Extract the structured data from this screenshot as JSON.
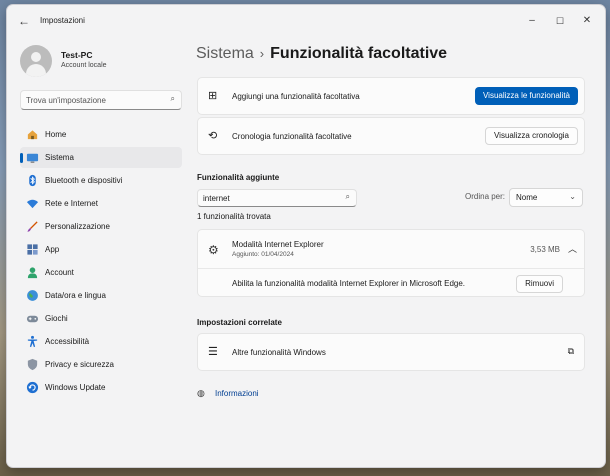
{
  "window": {
    "title": "Impostazioni",
    "back_glyph": "←",
    "min_glyph": "–",
    "max_glyph": "☐",
    "close_glyph": "✕"
  },
  "user": {
    "name": "Test-PC",
    "account_type": "Account locale"
  },
  "search": {
    "placeholder": "Trova un'impostazione",
    "icon": "search-icon"
  },
  "sidebar": {
    "selected": "Sistema",
    "items": [
      {
        "label": "Home",
        "icon": "home-icon"
      },
      {
        "label": "Sistema",
        "icon": "monitor-icon"
      },
      {
        "label": "Bluetooth e dispositivi",
        "icon": "bluetooth-icon"
      },
      {
        "label": "Rete e Internet",
        "icon": "wifi-icon"
      },
      {
        "label": "Personalizzazione",
        "icon": "brush-icon"
      },
      {
        "label": "App",
        "icon": "apps-icon"
      },
      {
        "label": "Account",
        "icon": "person-icon"
      },
      {
        "label": "Data/ora e lingua",
        "icon": "globe-clock-icon"
      },
      {
        "label": "Giochi",
        "icon": "gamepad-icon"
      },
      {
        "label": "Accessibilità",
        "icon": "accessibility-icon"
      },
      {
        "label": "Privacy e sicurezza",
        "icon": "shield-icon"
      },
      {
        "label": "Windows Update",
        "icon": "update-icon"
      }
    ]
  },
  "breadcrumb": {
    "root": "Sistema",
    "separator": "›",
    "current": "Funzionalità facoltative"
  },
  "actions": {
    "add": {
      "label": "Aggiungi una funzionalità facoltativa",
      "button": "Visualizza le funzionalità"
    },
    "history": {
      "label": "Cronologia funzionalità facoltative",
      "button": "Visualizza cronologia"
    }
  },
  "installed": {
    "title": "Funzionalità aggiunte",
    "search_value": "internet",
    "sort_label": "Ordina per:",
    "sort_value": "Nome",
    "result_count": "1 funzionalità trovata",
    "feature": {
      "name": "Modalità Internet Explorer",
      "added": "Aggiunto: 01/04/2024",
      "size": "3,53 MB",
      "description": "Abilita la funzionalità modalità Internet Explorer in Microsoft Edge.",
      "remove_button": "Rimuovi"
    }
  },
  "related": {
    "title": "Impostazioni correlate",
    "item": "Altre funzionalità Windows"
  },
  "info": {
    "label": "Informazioni"
  },
  "colors": {
    "accent": "#005fb8",
    "link": "#003e92"
  }
}
